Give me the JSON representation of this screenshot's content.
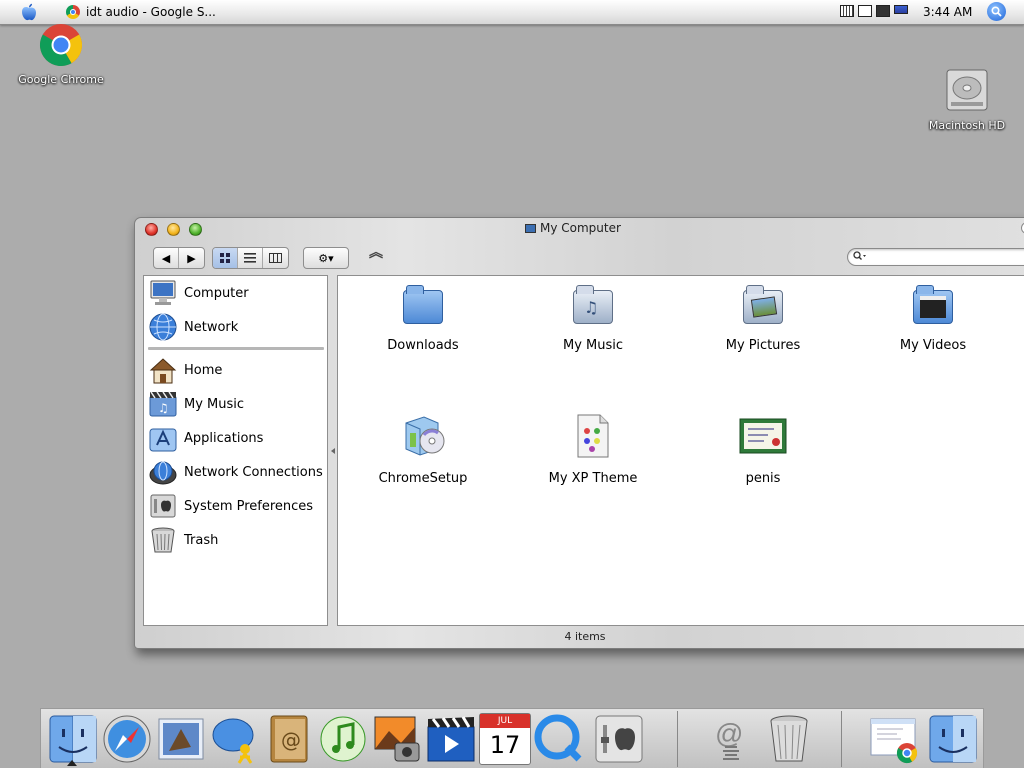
{
  "menubar": {
    "app_title": "idt audio - Google S...",
    "clock": "3:44 AM",
    "tray_icons": [
      "keyboard-icon",
      "display-icon",
      "monitor-icon",
      "battery-icon"
    ]
  },
  "desktop": {
    "icons": [
      {
        "label": "Google Chrome",
        "icon": "chrome-icon"
      },
      {
        "label": "Macintosh HD",
        "icon": "hard-drive-icon"
      }
    ]
  },
  "window": {
    "title": "My Computer",
    "status": "4 items",
    "toolbar": {
      "back": "◀",
      "forward": "▶",
      "views": [
        "icon-view",
        "list-view",
        "column-view"
      ],
      "active_view": "icon-view",
      "action": "⚙▾",
      "path": "︽",
      "search_placeholder": ""
    },
    "sidebar": {
      "devices": [
        {
          "label": "Computer",
          "icon": "computer-icon"
        },
        {
          "label": "Network",
          "icon": "network-globe-icon"
        }
      ],
      "places": [
        {
          "label": "Home",
          "icon": "home-icon"
        },
        {
          "label": "My Music",
          "icon": "music-icon"
        },
        {
          "label": "Applications",
          "icon": "applications-icon"
        },
        {
          "label": "Network Connections",
          "icon": "network-connections-icon"
        },
        {
          "label": "System Preferences",
          "icon": "system-preferences-icon"
        },
        {
          "label": "Trash",
          "icon": "trash-icon"
        }
      ]
    },
    "files": [
      {
        "label": "Downloads",
        "icon": "downloads-folder-icon"
      },
      {
        "label": "My Music",
        "icon": "music-folder-icon"
      },
      {
        "label": "My Pictures",
        "icon": "pictures-folder-icon"
      },
      {
        "label": "My Videos",
        "icon": "videos-folder-icon"
      },
      {
        "label": "ChromeSetup",
        "icon": "installer-icon"
      },
      {
        "label": "My XP Theme",
        "icon": "theme-document-icon"
      },
      {
        "label": "penis",
        "icon": "certificate-icon"
      }
    ]
  },
  "dock": {
    "items": [
      "finder-icon",
      "safari-icon",
      "mail-icon",
      "ichat-icon",
      "address-book-icon",
      "itunes-icon",
      "iphoto-icon",
      "imovie-icon",
      "ical-icon",
      "quicktime-icon",
      "system-preferences-icon",
      "at-sign-icon",
      "trash-icon",
      "chrome-document-icon",
      "finder-icon"
    ],
    "calendar": {
      "month": "JUL",
      "day": "17"
    }
  },
  "colors": {
    "desktop": "#acacac",
    "accent_blue": "#4d89d6",
    "close": "#e0342a",
    "minimize": "#f3b41c",
    "zoom": "#4fb22c"
  }
}
